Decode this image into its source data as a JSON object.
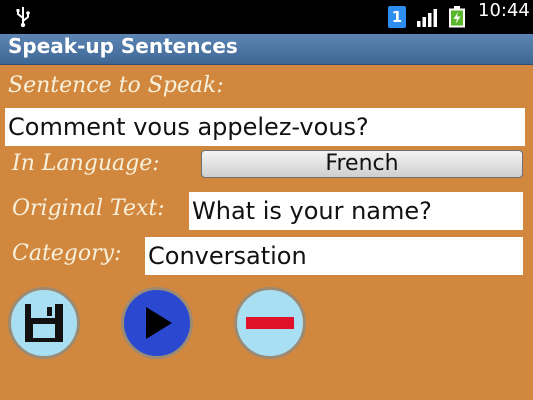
{
  "status_bar": {
    "time": "10:44",
    "sim_badge": "1",
    "icons": [
      "usb-icon",
      "sim-icon",
      "signal-icon",
      "battery-charging-icon"
    ]
  },
  "app": {
    "title": "Speak-up Sentences"
  },
  "form": {
    "sentence_label": "Sentence to Speak:",
    "sentence_value": "Comment vous appelez-vous?",
    "language_label": "In Language:",
    "language_value": "French",
    "original_label": "Original Text:",
    "original_value": "What is your name?",
    "category_label": "Category:",
    "category_value": "Conversation"
  },
  "buttons": {
    "save_icon": "floppy-disk-icon",
    "play_icon": "play-icon",
    "delete_icon": "minus-icon"
  },
  "colors": {
    "background": "#d2873e",
    "title_bar": "#4f77a6",
    "button_light": "#a9dff2",
    "button_play": "#2b49d0",
    "delete_bar": "#e0112b"
  }
}
